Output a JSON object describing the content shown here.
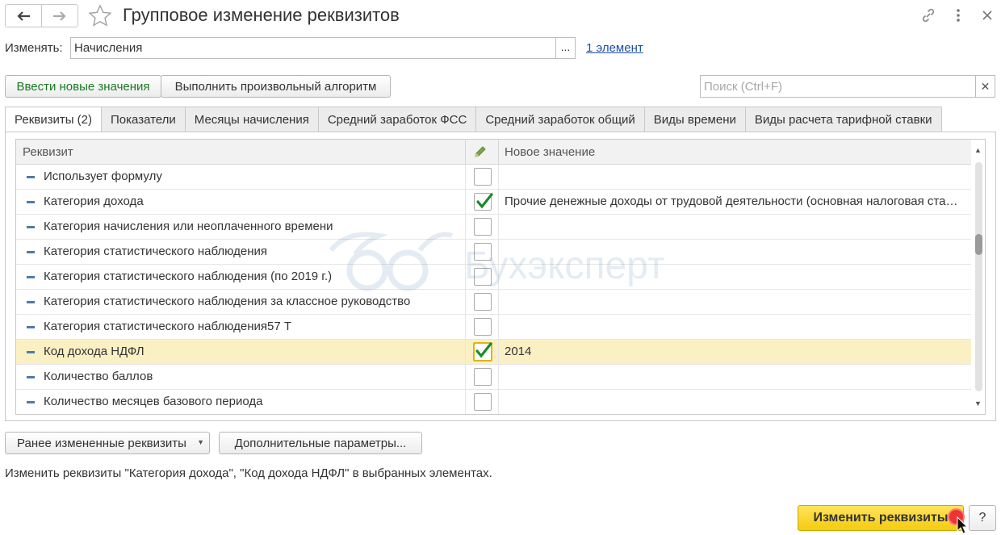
{
  "window": {
    "title": "Групповое изменение реквизитов"
  },
  "form": {
    "change_label": "Изменять:",
    "change_value": "Начисления",
    "elements_link": "1 элемент"
  },
  "actions": {
    "new_values": "Ввести новые значения",
    "run_algorithm": "Выполнить произвольный алгоритм",
    "search_placeholder": "Поиск (Ctrl+F)"
  },
  "tabs": [
    {
      "label": "Реквизиты (2)",
      "active": true
    },
    {
      "label": "Показатели"
    },
    {
      "label": "Месяцы начисления"
    },
    {
      "label": "Средний заработок ФСС"
    },
    {
      "label": "Средний заработок общий"
    },
    {
      "label": "Виды времени"
    },
    {
      "label": "Виды расчета тарифной ставки"
    }
  ],
  "grid": {
    "col_attr": "Реквизит",
    "col_value": "Новое значение",
    "rows": [
      {
        "name": "Использует формулу",
        "checked": false,
        "value": ""
      },
      {
        "name": "Категория дохода",
        "checked": true,
        "value": "Прочие денежные доходы от трудовой деятельности (основная налоговая ставка)"
      },
      {
        "name": "Категория начисления или неоплаченного времени",
        "checked": false,
        "value": ""
      },
      {
        "name": "Категория статистического наблюдения",
        "checked": false,
        "value": ""
      },
      {
        "name": "Категория статистического наблюдения (по 2019 г.)",
        "checked": false,
        "value": ""
      },
      {
        "name": "Категория статистического наблюдения за классное руководство",
        "checked": false,
        "value": ""
      },
      {
        "name": "Категория статистического наблюдения57 Т",
        "checked": false,
        "value": ""
      },
      {
        "name": "Код дохода НДФЛ",
        "checked": true,
        "value": "2014",
        "selected": true
      },
      {
        "name": "Количество баллов",
        "checked": false,
        "value": ""
      },
      {
        "name": "Количество месяцев базового периода",
        "checked": false,
        "value": ""
      }
    ]
  },
  "bottom": {
    "prev_changed": "Ранее измененные реквизиты",
    "extra_params": "Дополнительные параметры...",
    "status": "Изменить реквизиты \"Категория дохода\", \"Код дохода НДФЛ\" в выбранных элементах.",
    "apply": "Изменить реквизиты",
    "help": "?"
  },
  "watermark": "Бухэксперт",
  "colors": {
    "apply_bg": "#f4cb0f",
    "selected_row": "#fbf0c4",
    "check": "#1a8a2a",
    "link": "#1d51a6"
  }
}
